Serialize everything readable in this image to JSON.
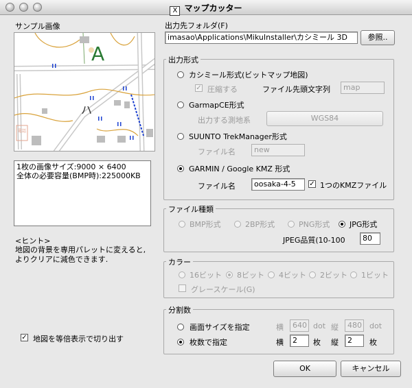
{
  "window": {
    "title": "マップカッター",
    "x_logo": "X"
  },
  "sample": {
    "label": "サンプル画像",
    "map_letters": {
      "a": "A",
      "ha": "ハ",
      "stamp": "電話"
    },
    "info_lines": [
      "1枚の画像サイズ:9000 × 6400",
      "全体の必要容量(BMP時):225000KB"
    ],
    "hint_title": "<ヒント>",
    "hint_lines": [
      "地図の背景を専用パレットに変えると,",
      "よりクリアに減色できます."
    ],
    "fixed_scale_checkbox": "地図を等倍表示で切り出す"
  },
  "output_folder": {
    "label": "出力先フォルダ(F)",
    "value": "imasao\\Applications\\MikuInstaller\\カシミール 3D",
    "browse_button": "参照.."
  },
  "output_format": {
    "group_label": "出力形式",
    "kashmir": {
      "label": "カシミール形式(ビットマップ地図)",
      "compress_label": "圧縮する",
      "prefix_label": "ファイル先頭文字列",
      "prefix_value": "map"
    },
    "garmapce": {
      "label": "GarmapCE形式",
      "datum_label": "出力する測地系",
      "datum_button": "WGS84"
    },
    "suunto": {
      "label": "SUUNTO TrekManager形式",
      "filename_label": "ファイル名",
      "filename_value": "new"
    },
    "garmin": {
      "label": "GARMIN / Google KMZ 形式",
      "filename_label": "ファイル名",
      "filename_value": "oosaka-4-5",
      "single_kmz_label": "1つのKMZファイル"
    }
  },
  "file_type": {
    "group_label": "ファイル種類",
    "options": [
      "BMP形式",
      "2BP形式",
      "PNG形式",
      "JPG形式"
    ],
    "selected": "JPG形式",
    "jpeg_quality_label": "JPEG品質(10-100",
    "jpeg_quality_value": "80"
  },
  "color": {
    "group_label": "カラー",
    "options": [
      "16ビット",
      "8ビット",
      "4ビット",
      "2ビット",
      "1ビット"
    ],
    "selected": "8ビット",
    "grayscale_label": "グレースケール(G)"
  },
  "split": {
    "group_label": "分割数",
    "by_screen_label": "画面サイズを指定",
    "by_count_label": "枚数で指定",
    "selected": "枚数で指定",
    "screen_h_label": "横",
    "screen_h_value": "640",
    "screen_h_unit": "dot",
    "screen_v_label": "縦",
    "screen_v_value": "480",
    "screen_v_unit": "dot",
    "count_h_label": "横",
    "count_h_value": "2",
    "count_h_unit": "枚",
    "count_v_label": "縦",
    "count_v_value": "2",
    "count_v_unit": "枚"
  },
  "buttons": {
    "ok": "OK",
    "cancel": "キャンセル"
  }
}
